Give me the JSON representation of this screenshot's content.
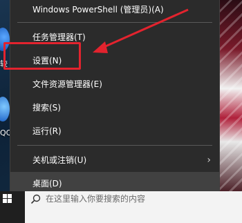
{
  "desktop": {
    "labels": [
      "较",
      "QQ"
    ]
  },
  "context_menu": {
    "items": [
      {
        "label": "Windows PowerShell (管理员)(A)"
      },
      {
        "label": "任务管理器(T)"
      },
      {
        "label": "设置(N)"
      },
      {
        "label": "文件资源管理器(E)"
      },
      {
        "label": "搜索(S)"
      },
      {
        "label": "运行(R)"
      },
      {
        "label": "关机或注销(U)",
        "submenu": true
      },
      {
        "label": "桌面(D)"
      }
    ],
    "highlighted_item": "桌面(D)"
  },
  "annotation": {
    "highlighted_item": "设置(N)",
    "color": "#e3232e"
  },
  "taskbar": {
    "search_placeholder": "在这里输入你要搜索的内容"
  },
  "icons": {
    "start": "windows-logo-icon",
    "search": "search-icon",
    "submenu": "chevron-right-icon"
  },
  "colors": {
    "menu_bg": "#2b2b2b",
    "menu_hover": "#414141",
    "annotation_red": "#e3232e"
  }
}
